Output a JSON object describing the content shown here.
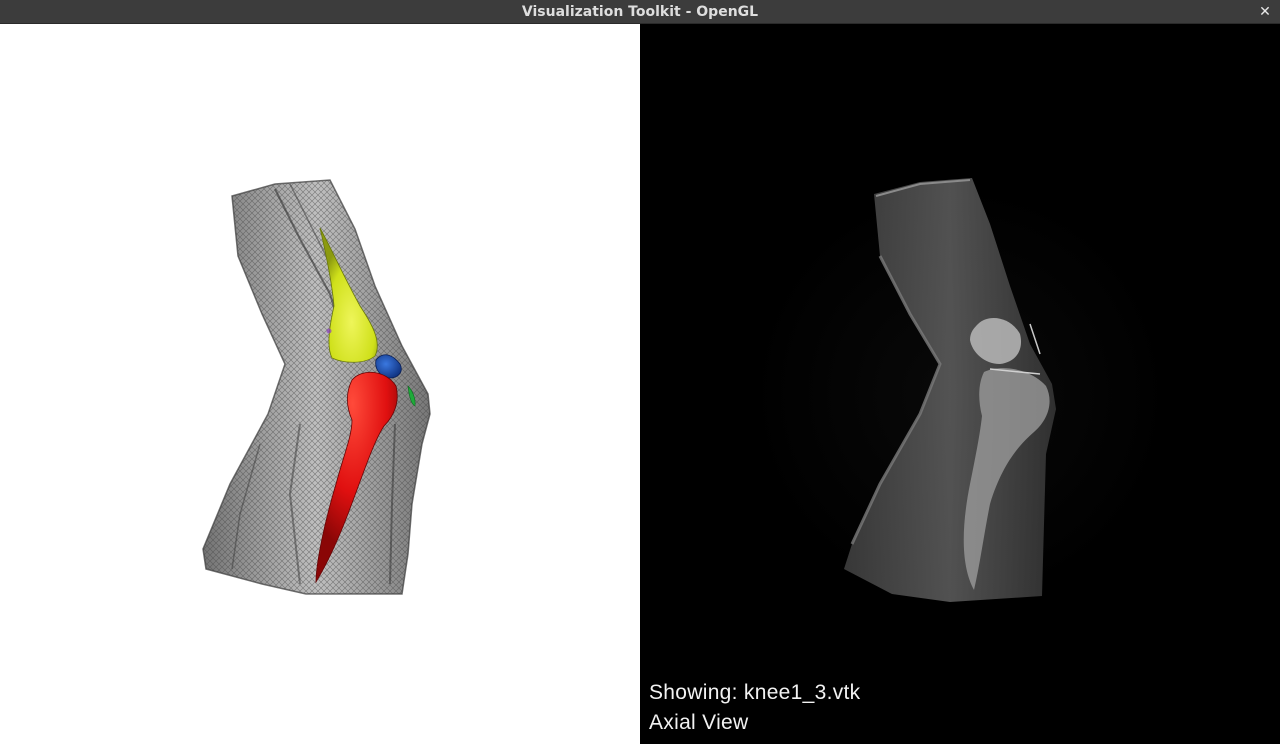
{
  "window": {
    "title": "Visualization Toolkit - OpenGL",
    "close_glyph": "✕"
  },
  "left_view": {
    "background": "#ffffff",
    "structures": [
      {
        "name": "femur",
        "color": "#d4e21f"
      },
      {
        "name": "patella",
        "color": "#1c4fb8"
      },
      {
        "name": "tibia",
        "color": "#e01010"
      },
      {
        "name": "ligament",
        "color": "#1faa3a"
      }
    ]
  },
  "right_view": {
    "background": "#000000",
    "overlay": {
      "line1": "Showing: knee1_3.vtk",
      "line2": "Axial View"
    }
  }
}
